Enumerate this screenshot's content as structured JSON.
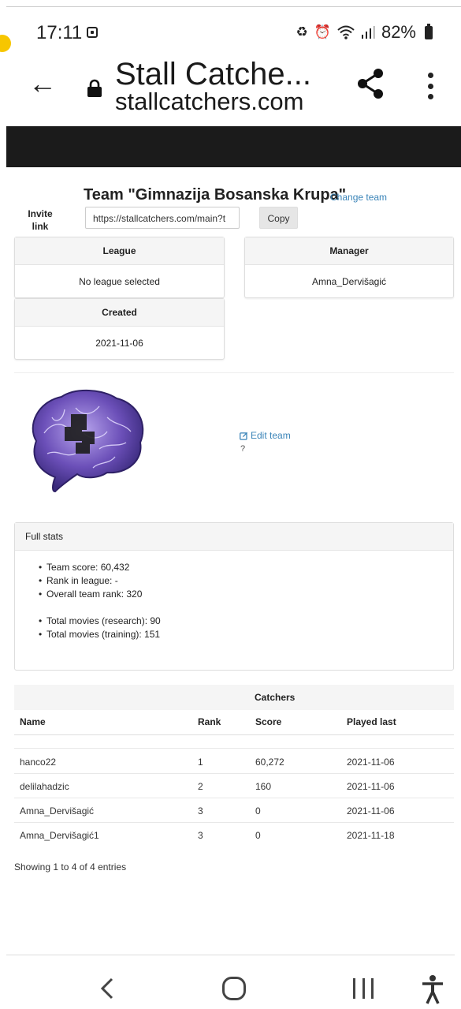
{
  "status_bar": {
    "time": "17:11",
    "battery": "82%"
  },
  "browser": {
    "title": "Stall Catche...",
    "url": "stallcatchers.com"
  },
  "team": {
    "title": "Team \"Gimnazija Bosanska Krupa\"",
    "change_team": "Change team",
    "invite_label": "Invite link",
    "invite_value": "https://stallcatchers.com/main?t",
    "copy_label": "Copy",
    "edit_team": "Edit team",
    "unknown": "?"
  },
  "cards": {
    "league": {
      "title": "League",
      "value": "No league selected"
    },
    "manager": {
      "title": "Manager",
      "value": "Amna_Dervišagić"
    },
    "created": {
      "title": "Created",
      "value": "2021-11-06"
    }
  },
  "stats": {
    "title": "Full stats",
    "items": [
      "Team score: 60,432",
      "Rank in league: -",
      "Overall team rank: 320",
      "Total movies (research): 90",
      "Total movies (training): 151"
    ]
  },
  "catchers": {
    "title": "Catchers",
    "columns": [
      "Name",
      "Rank",
      "Score",
      "Played last"
    ],
    "rows": [
      [
        "hanco22",
        "1",
        "60,272",
        "2021-11-06"
      ],
      [
        "delilahadzic",
        "2",
        "160",
        "2021-11-06"
      ],
      [
        "Amna_Dervišagić",
        "3",
        "0",
        "2021-11-06"
      ],
      [
        "Amna_Dervišagić1",
        "3",
        "0",
        "2021-11-18"
      ]
    ],
    "footer": "Showing 1 to 4 of 4 entries"
  },
  "icons": {
    "status": [
      "gallery-icon",
      "recycle-icon",
      "alarm-icon",
      "wifi-icon",
      "signal-icon",
      "battery-icon"
    ],
    "toolbar": [
      "back-arrow-icon",
      "lock-icon",
      "share-icon",
      "more-vert-icon"
    ],
    "nav": [
      "nav-back-icon",
      "nav-home-icon",
      "nav-recents-icon",
      "accessibility-icon"
    ]
  },
  "colors": {
    "link": "#3a84b8",
    "header": "#1b1b1b",
    "brain": "#6b4fb8"
  }
}
